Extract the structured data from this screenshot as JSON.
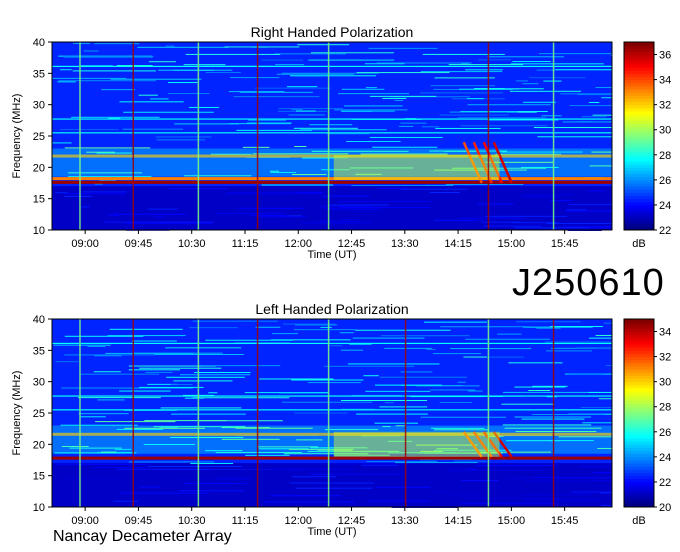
{
  "observation_id": "J250610",
  "footer": "Nancay Decameter Array",
  "chart_data": [
    {
      "type": "heatmap",
      "title": "Right Handed Polarization",
      "xlabel": "Time (UT)",
      "ylabel": "Frequency (MHz)",
      "x_ticks": [
        "09:00",
        "09:45",
        "10:30",
        "11:15",
        "12:00",
        "12:45",
        "13:30",
        "14:15",
        "15:00",
        "15:45"
      ],
      "y_ticks": [
        10,
        15,
        20,
        25,
        30,
        35,
        40
      ],
      "ylim": [
        10,
        40
      ],
      "colorbar": {
        "label": "dB",
        "range": [
          22,
          37
        ],
        "ticks": [
          22,
          24,
          26,
          28,
          30,
          32,
          34,
          36
        ]
      },
      "features": {
        "strong_bands_mhz": [
          17.6,
          18.2,
          21.8
        ],
        "bright_columns_ut": [
          "08:55",
          "09:40",
          "10:35",
          "11:25",
          "12:25",
          "14:40",
          "15:35"
        ],
        "burst_center_ut": "14:35",
        "burst_freq_range_mhz": [
          17.5,
          24
        ]
      }
    },
    {
      "type": "heatmap",
      "title": "Left Handed Polarization",
      "xlabel": "Time (UT)",
      "ylabel": "Frequency (MHz)",
      "x_ticks": [
        "09:00",
        "09:45",
        "10:30",
        "11:15",
        "12:00",
        "12:45",
        "13:30",
        "14:15",
        "15:00",
        "15:45"
      ],
      "y_ticks": [
        10,
        15,
        20,
        25,
        30,
        35,
        40
      ],
      "ylim": [
        10,
        40
      ],
      "colorbar": {
        "label": "dB",
        "range": [
          20,
          35
        ],
        "ticks": [
          20,
          22,
          24,
          26,
          28,
          30,
          32,
          34
        ]
      },
      "features": {
        "strong_bands_mhz": [
          17.8,
          21.6
        ],
        "bright_columns_ut": [
          "08:55",
          "09:40",
          "10:35",
          "11:25",
          "12:25",
          "13:30",
          "14:40",
          "15:35"
        ],
        "burst_center_ut": "14:35",
        "burst_freq_range_mhz": [
          18,
          22
        ]
      }
    }
  ]
}
